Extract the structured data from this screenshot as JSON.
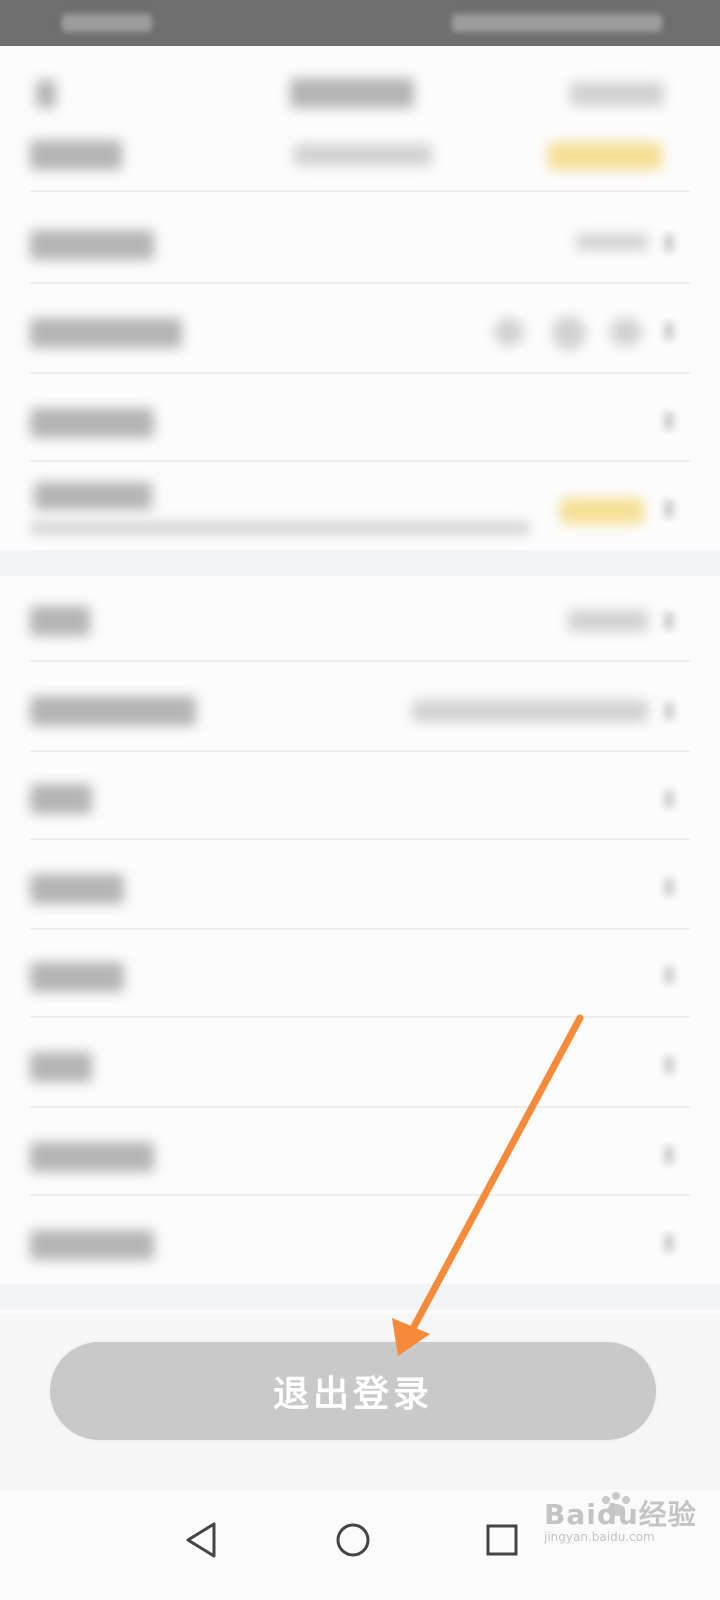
{
  "logout": {
    "label": "退出登录"
  },
  "icons": {
    "back": "back-triangle-icon",
    "home": "home-circle-icon",
    "recents": "recents-square-icon",
    "annotation": "orange-arrow-icon"
  },
  "colors": {
    "status_bar": "#6f6f6f",
    "logout_button": "#c9c9c9",
    "arrow": "#f58a3a",
    "badge_yellow": "#f3d46a"
  },
  "watermark": {
    "brand": "Baidu经验",
    "url": "jingyan.baidu.com"
  }
}
